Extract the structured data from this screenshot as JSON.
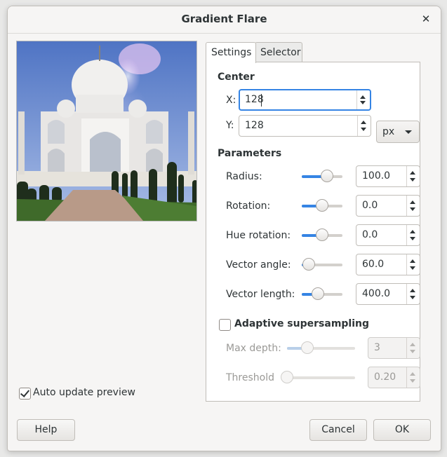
{
  "window": {
    "title": "Gradient Flare",
    "close_glyph": "✕"
  },
  "preview": {
    "auto_update_label": "Auto update preview",
    "auto_update_checked": true
  },
  "tabs": [
    {
      "label": "Settings",
      "active": true
    },
    {
      "label": "Selector",
      "active": false
    }
  ],
  "center": {
    "heading": "Center",
    "x_label": "X:",
    "x_value": "128",
    "y_label": "Y:",
    "y_value": "128",
    "unit": "px"
  },
  "parameters": {
    "heading": "Parameters",
    "radius": {
      "label": "Radius:",
      "value": "100.0",
      "level": 0.62
    },
    "rotation": {
      "label": "Rotation:",
      "value": "0.0",
      "level": 0.5
    },
    "hue_rotation": {
      "label": "Hue rotation:",
      "value": "0.0",
      "level": 0.5
    },
    "vector_angle": {
      "label": "Vector angle:",
      "value": "60.0",
      "level": 0.17
    },
    "vector_length": {
      "label": "Vector length:",
      "value": "400.0",
      "level": 0.4
    }
  },
  "supersampling": {
    "label": "Adaptive supersampling",
    "checked": false,
    "max_depth": {
      "label": "Max depth:",
      "value": "3",
      "level": 0.3
    },
    "threshold": {
      "label": "Threshold",
      "value": "0.20",
      "level": 0.0
    }
  },
  "buttons": {
    "help": "Help",
    "cancel": "Cancel",
    "ok": "OK"
  },
  "colors": {
    "accent": "#3584e4",
    "sky": "#5b7fc8",
    "grass": "#3f6a2a"
  }
}
